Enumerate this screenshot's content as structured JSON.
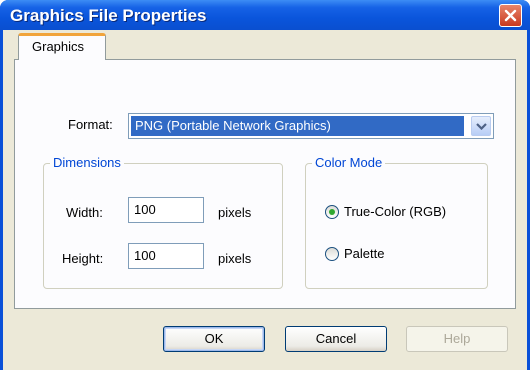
{
  "window": {
    "title": "Graphics File Properties"
  },
  "tabs": [
    {
      "label": "Graphics"
    }
  ],
  "format": {
    "label": "Format:",
    "selected": "PNG (Portable Network Graphics)"
  },
  "dimensions": {
    "title": "Dimensions",
    "width_label": "Width:",
    "width_value": "100",
    "height_label": "Height:",
    "height_value": "100",
    "unit": "pixels"
  },
  "color_mode": {
    "title": "Color Mode",
    "options": [
      {
        "label": "True-Color (RGB)",
        "selected": true
      },
      {
        "label": "Palette",
        "selected": false
      }
    ]
  },
  "buttons": {
    "ok": "OK",
    "cancel": "Cancel",
    "help": "Help"
  },
  "icons": {
    "close": "close-icon",
    "dropdown": "chevron-down-icon"
  },
  "colors": {
    "titlebar": "#0a55dc",
    "accent_tab": "#f1a43b",
    "selection": "#316ac5",
    "group_title": "#0046d5"
  }
}
